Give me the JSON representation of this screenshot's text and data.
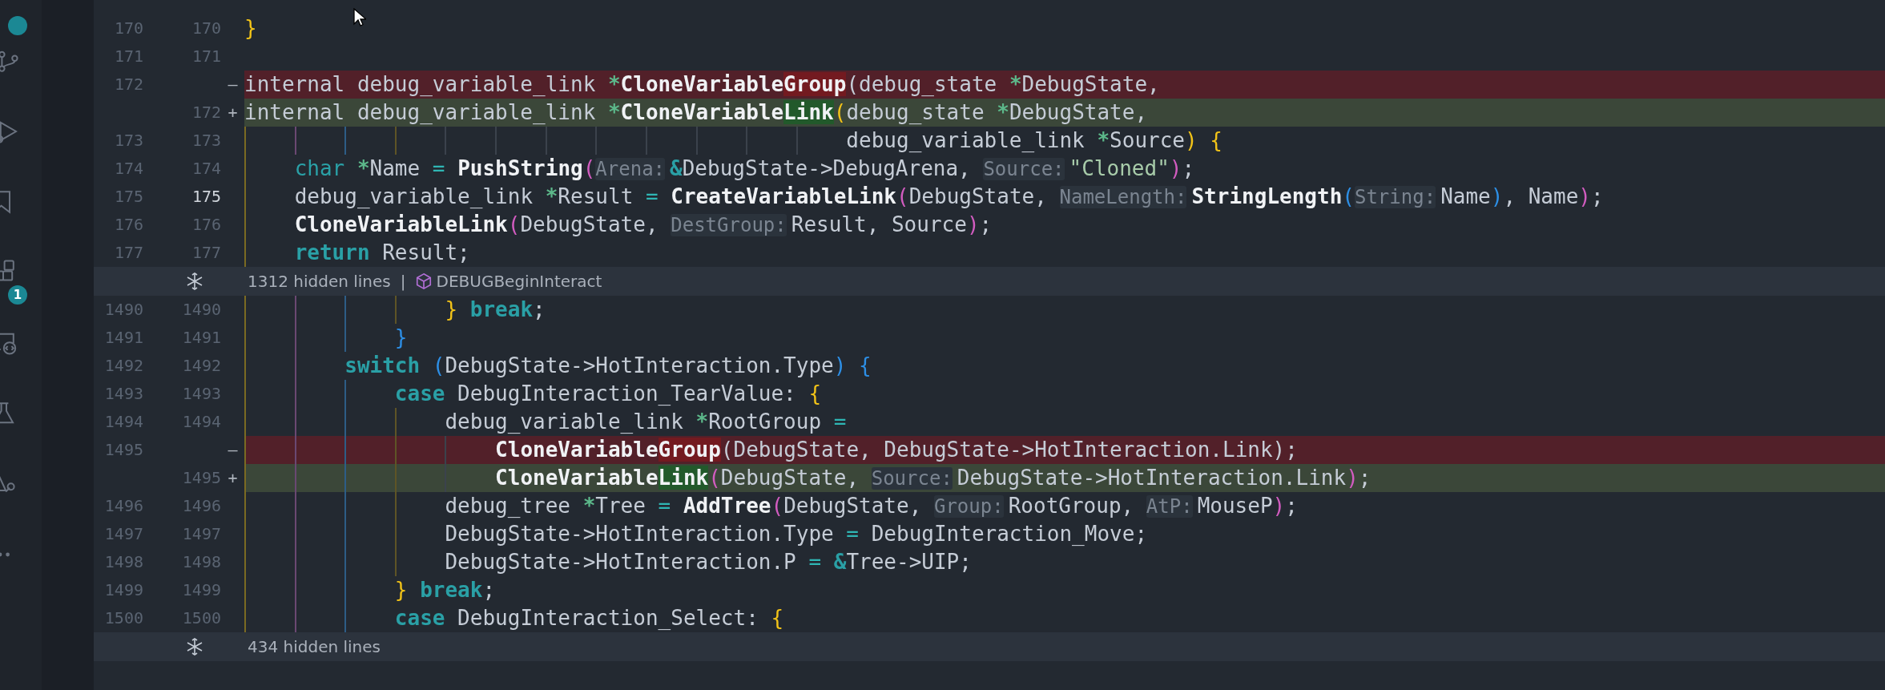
{
  "activity_bar": [
    {
      "kind": "top"
    },
    {
      "kind": "branch"
    },
    {
      "kind": "debug"
    },
    {
      "kind": "bookmark"
    },
    {
      "kind": "extensions",
      "badge": "1"
    },
    {
      "kind": "remote"
    },
    {
      "kind": "flask"
    },
    {
      "kind": "tools"
    },
    {
      "kind": "more"
    }
  ],
  "rows": [
    {
      "kind": "line",
      "old": "170",
      "new": "170",
      "removed": false,
      "added": false,
      "current": false,
      "tokens": [
        {
          "text": "}",
          "kind": "y"
        }
      ]
    },
    {
      "kind": "line",
      "old": "171",
      "new": "171",
      "removed": false,
      "added": false,
      "current": false,
      "tokens": []
    },
    {
      "kind": "line",
      "old": "172",
      "sign": "—",
      "removed": true,
      "added": false,
      "tokens": [
        {
          "text": "internal debug_variable_link ",
          "kind": "plain"
        },
        {
          "text": "*",
          "kind": "ptr"
        },
        {
          "text": "CloneVariable",
          "kind": "fn"
        },
        {
          "text": "Group",
          "kind": "fnDel"
        },
        {
          "text": "(debug_state ",
          "kind": "plain"
        },
        {
          "text": "*",
          "kind": "ptr"
        },
        {
          "text": "DebugState,",
          "kind": "plain"
        }
      ]
    },
    {
      "kind": "line",
      "new": "172",
      "sign": "+",
      "removed": false,
      "added": true,
      "current": false,
      "tokens": [
        {
          "text": "internal debug_variable_link ",
          "kind": "plain"
        },
        {
          "text": "*",
          "kind": "ptr"
        },
        {
          "text": "CloneVariable",
          "kind": "fn"
        },
        {
          "text": "Link",
          "kind": "fnAdd"
        },
        {
          "text": "(",
          "kind": "y"
        },
        {
          "text": "debug_state ",
          "kind": "plain"
        },
        {
          "text": "*",
          "kind": "ptr"
        },
        {
          "text": "DebugState,",
          "kind": "plain"
        }
      ]
    },
    {
      "kind": "line",
      "old": "173",
      "new": "173",
      "removed": false,
      "added": false,
      "current": false,
      "tokens": [
        {
          "text": "                                                debug_variable_link ",
          "kind": "plain"
        },
        {
          "text": "*",
          "kind": "ptr"
        },
        {
          "text": "Source",
          "kind": "plain"
        },
        {
          "text": ")",
          "kind": "y"
        },
        {
          "text": " {",
          "kind": "y"
        }
      ]
    },
    {
      "kind": "line",
      "old": "174",
      "new": "174",
      "removed": false,
      "added": false,
      "current": false,
      "tokens": [
        {
          "text": "    char ",
          "kind": "type"
        },
        {
          "text": "*",
          "kind": "ptr"
        },
        {
          "text": "Name ",
          "kind": "plain"
        },
        {
          "text": "= ",
          "kind": "op"
        },
        {
          "text": "PushString",
          "kind": "fn"
        },
        {
          "text": "(",
          "kind": "m"
        },
        {
          "text": "Arena:",
          "kind": "hint"
        },
        {
          "text": "&",
          "kind": "amp"
        },
        {
          "text": "DebugState->DebugArena, ",
          "kind": "plain"
        },
        {
          "text": "Source:",
          "kind": "hint"
        },
        {
          "text": "\"Cloned\"",
          "kind": "str"
        },
        {
          "text": ")",
          "kind": "m"
        },
        {
          "text": ";",
          "kind": "plain"
        }
      ]
    },
    {
      "kind": "line",
      "old": "175",
      "new": "175",
      "removed": false,
      "added": false,
      "current": true,
      "tokens": [
        {
          "text": "    debug_variable_link ",
          "kind": "plain"
        },
        {
          "text": "*",
          "kind": "ptr"
        },
        {
          "text": "Result ",
          "kind": "plain"
        },
        {
          "text": "= ",
          "kind": "op"
        },
        {
          "text": "CreateVariableLink",
          "kind": "fn"
        },
        {
          "text": "(",
          "kind": "m"
        },
        {
          "text": "DebugState, ",
          "kind": "plain"
        },
        {
          "text": "NameLength:",
          "kind": "hint"
        },
        {
          "text": "StringLength",
          "kind": "fn"
        },
        {
          "text": "(",
          "kind": "b"
        },
        {
          "text": "String:",
          "kind": "hint"
        },
        {
          "text": "Name",
          "kind": "plain"
        },
        {
          "text": ")",
          "kind": "b"
        },
        {
          "text": ", Name",
          "kind": "plain"
        },
        {
          "text": ")",
          "kind": "m"
        },
        {
          "text": ";",
          "kind": "plain"
        }
      ]
    },
    {
      "kind": "line",
      "old": "176",
      "new": "176",
      "removed": false,
      "added": false,
      "current": false,
      "tokens": [
        {
          "text": "    CloneVariableLink",
          "kind": "fn"
        },
        {
          "text": "(",
          "kind": "m"
        },
        {
          "text": "DebugState, ",
          "kind": "plain"
        },
        {
          "text": "DestGroup:",
          "kind": "hint"
        },
        {
          "text": "Result, Source",
          "kind": "plain"
        },
        {
          "text": ")",
          "kind": "m"
        },
        {
          "text": ";",
          "kind": "plain"
        }
      ]
    },
    {
      "kind": "line",
      "old": "177",
      "new": "177",
      "removed": false,
      "added": false,
      "current": false,
      "tokens": [
        {
          "text": "    return",
          "kind": "kw"
        },
        {
          "text": " Result;",
          "kind": "plain"
        }
      ]
    },
    {
      "kind": "fold",
      "text": "1312 hidden lines",
      "separator": "|",
      "symbol": "DEBUGBeginInteract"
    },
    {
      "kind": "line",
      "old": "1490",
      "new": "1490",
      "removed": false,
      "added": false,
      "current": false,
      "tokens": [
        {
          "text": "                }",
          "kind": "y"
        },
        {
          "text": " break",
          "kind": "kw"
        },
        {
          "text": ";",
          "kind": "plain"
        }
      ]
    },
    {
      "kind": "line",
      "old": "1491",
      "new": "1491",
      "removed": false,
      "added": false,
      "current": false,
      "tokens": [
        {
          "text": "            }",
          "kind": "b"
        }
      ]
    },
    {
      "kind": "line",
      "old": "1492",
      "new": "1492",
      "removed": false,
      "added": false,
      "current": false,
      "tokens": [
        {
          "text": "        switch ",
          "kind": "kw"
        },
        {
          "text": "(",
          "kind": "b"
        },
        {
          "text": "DebugState->HotInteraction.Type",
          "kind": "plain"
        },
        {
          "text": ")",
          "kind": "b"
        },
        {
          "text": " {",
          "kind": "b"
        }
      ]
    },
    {
      "kind": "line",
      "old": "1493",
      "new": "1493",
      "removed": false,
      "added": false,
      "current": false,
      "tokens": [
        {
          "text": "            case",
          "kind": "kw"
        },
        {
          "text": " DebugInteraction_TearValue: ",
          "kind": "plain"
        },
        {
          "text": "{",
          "kind": "y"
        }
      ]
    },
    {
      "kind": "line",
      "old": "1494",
      "new": "1494",
      "removed": false,
      "added": false,
      "current": false,
      "tokens": [
        {
          "text": "                debug_variable_link ",
          "kind": "plain"
        },
        {
          "text": "*",
          "kind": "ptr"
        },
        {
          "text": "RootGroup ",
          "kind": "plain"
        },
        {
          "text": "=",
          "kind": "op"
        }
      ]
    },
    {
      "kind": "line",
      "old": "1495",
      "sign": "—",
      "removed": true,
      "added": false,
      "tokens": [
        {
          "text": "                    CloneVariable",
          "kind": "fn"
        },
        {
          "text": "Group",
          "kind": "fnDel"
        },
        {
          "text": "(DebugState, DebugState->HotInteraction.Link);",
          "kind": "plain"
        }
      ]
    },
    {
      "kind": "line",
      "new": "1495",
      "sign": "+",
      "removed": false,
      "added": true,
      "current": false,
      "tokens": [
        {
          "text": "                    CloneVariable",
          "kind": "fn"
        },
        {
          "text": "Link",
          "kind": "fnAdd"
        },
        {
          "text": "(",
          "kind": "m"
        },
        {
          "text": "DebugState, ",
          "kind": "plain"
        },
        {
          "text": "Source:",
          "kind": "hint"
        },
        {
          "text": "DebugState->HotInteraction.Link",
          "kind": "plain"
        },
        {
          "text": ")",
          "kind": "m"
        },
        {
          "text": ";",
          "kind": "plain"
        }
      ]
    },
    {
      "kind": "line",
      "old": "1496",
      "new": "1496",
      "removed": false,
      "added": false,
      "current": false,
      "tokens": [
        {
          "text": "                debug_tree ",
          "kind": "plain"
        },
        {
          "text": "*",
          "kind": "ptr"
        },
        {
          "text": "Tree ",
          "kind": "plain"
        },
        {
          "text": "= ",
          "kind": "op"
        },
        {
          "text": "AddTree",
          "kind": "fn"
        },
        {
          "text": "(",
          "kind": "m"
        },
        {
          "text": "DebugState, ",
          "kind": "plain"
        },
        {
          "text": "Group:",
          "kind": "hint"
        },
        {
          "text": "RootGroup, ",
          "kind": "plain"
        },
        {
          "text": "AtP:",
          "kind": "hint"
        },
        {
          "text": "MouseP",
          "kind": "plain"
        },
        {
          "text": ")",
          "kind": "m"
        },
        {
          "text": ";",
          "kind": "plain"
        }
      ]
    },
    {
      "kind": "line",
      "old": "1497",
      "new": "1497",
      "removed": false,
      "added": false,
      "current": false,
      "tokens": [
        {
          "text": "                DebugState->HotInteraction.Type ",
          "kind": "plain"
        },
        {
          "text": "=",
          "kind": "op"
        },
        {
          "text": " DebugInteraction_Move;",
          "kind": "plain"
        }
      ]
    },
    {
      "kind": "line",
      "old": "1498",
      "new": "1498",
      "removed": false,
      "added": false,
      "current": false,
      "tokens": [
        {
          "text": "                DebugState->HotInteraction.P ",
          "kind": "plain"
        },
        {
          "text": "= ",
          "kind": "op"
        },
        {
          "text": "&",
          "kind": "amp"
        },
        {
          "text": "Tree->UIP;",
          "kind": "plain"
        }
      ]
    },
    {
      "kind": "line",
      "old": "1499",
      "new": "1499",
      "removed": false,
      "added": false,
      "current": false,
      "tokens": [
        {
          "text": "            }",
          "kind": "y"
        },
        {
          "text": " break",
          "kind": "kw"
        },
        {
          "text": ";",
          "kind": "plain"
        }
      ]
    },
    {
      "kind": "line",
      "old": "1500",
      "new": "1500",
      "removed": false,
      "added": false,
      "current": false,
      "tokens": [
        {
          "text": "            case",
          "kind": "kw"
        },
        {
          "text": " DebugInteraction_Select: ",
          "kind": "plain"
        },
        {
          "text": "{",
          "kind": "y"
        }
      ]
    },
    {
      "kind": "fold",
      "text": "434 hidden lines"
    }
  ]
}
